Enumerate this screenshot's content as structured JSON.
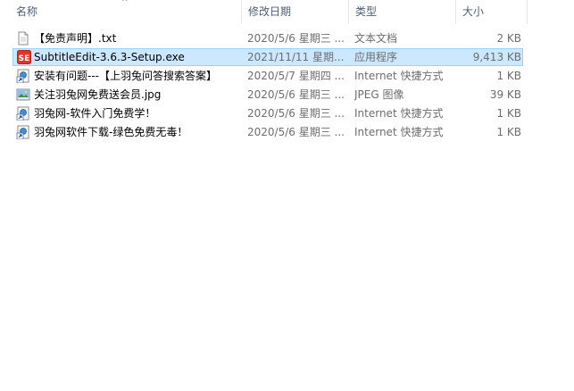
{
  "columns": {
    "name": "名称",
    "date": "修改日期",
    "type": "类型",
    "size": "大小"
  },
  "sort_indicator": "^",
  "files": [
    {
      "name": "【免责声明】.txt",
      "date": "2020/5/6 星期三 ...",
      "type": "文本文档",
      "size": "2 KB",
      "icon": "text-file-icon"
    },
    {
      "name": "SubtitleEdit-3.6.3-Setup.exe",
      "date": "2021/11/11 星期...",
      "type": "应用程序",
      "size": "9,413 KB",
      "icon": "subtitle-edit-app-icon",
      "selected": true
    },
    {
      "name": "安装有问题---【上羽兔问答搜索答案】",
      "date": "2020/5/7 星期四 ...",
      "type": "Internet 快捷方式",
      "size": "1 KB",
      "icon": "internet-shortcut-icon"
    },
    {
      "name": "关注羽兔网免费送会员.jpg",
      "date": "2020/5/6 星期三 ...",
      "type": "JPEG 图像",
      "size": "39 KB",
      "icon": "jpeg-image-icon"
    },
    {
      "name": "羽兔网-软件入门免费学！",
      "date": "2020/5/6 星期三 ...",
      "type": "Internet 快捷方式",
      "size": "1 KB",
      "icon": "internet-shortcut-icon"
    },
    {
      "name": "羽兔网软件下载-绿色免费无毒！",
      "date": "2020/5/6 星期三 ...",
      "type": "Internet 快捷方式",
      "size": "1 KB",
      "icon": "internet-shortcut-icon"
    }
  ],
  "colors": {
    "selection_bg": "#cce8ff",
    "selection_border": "#99d1ff",
    "header_text": "#4c607a",
    "detail_text": "#6d6d6d",
    "app_icon_red": "#e0352b"
  }
}
